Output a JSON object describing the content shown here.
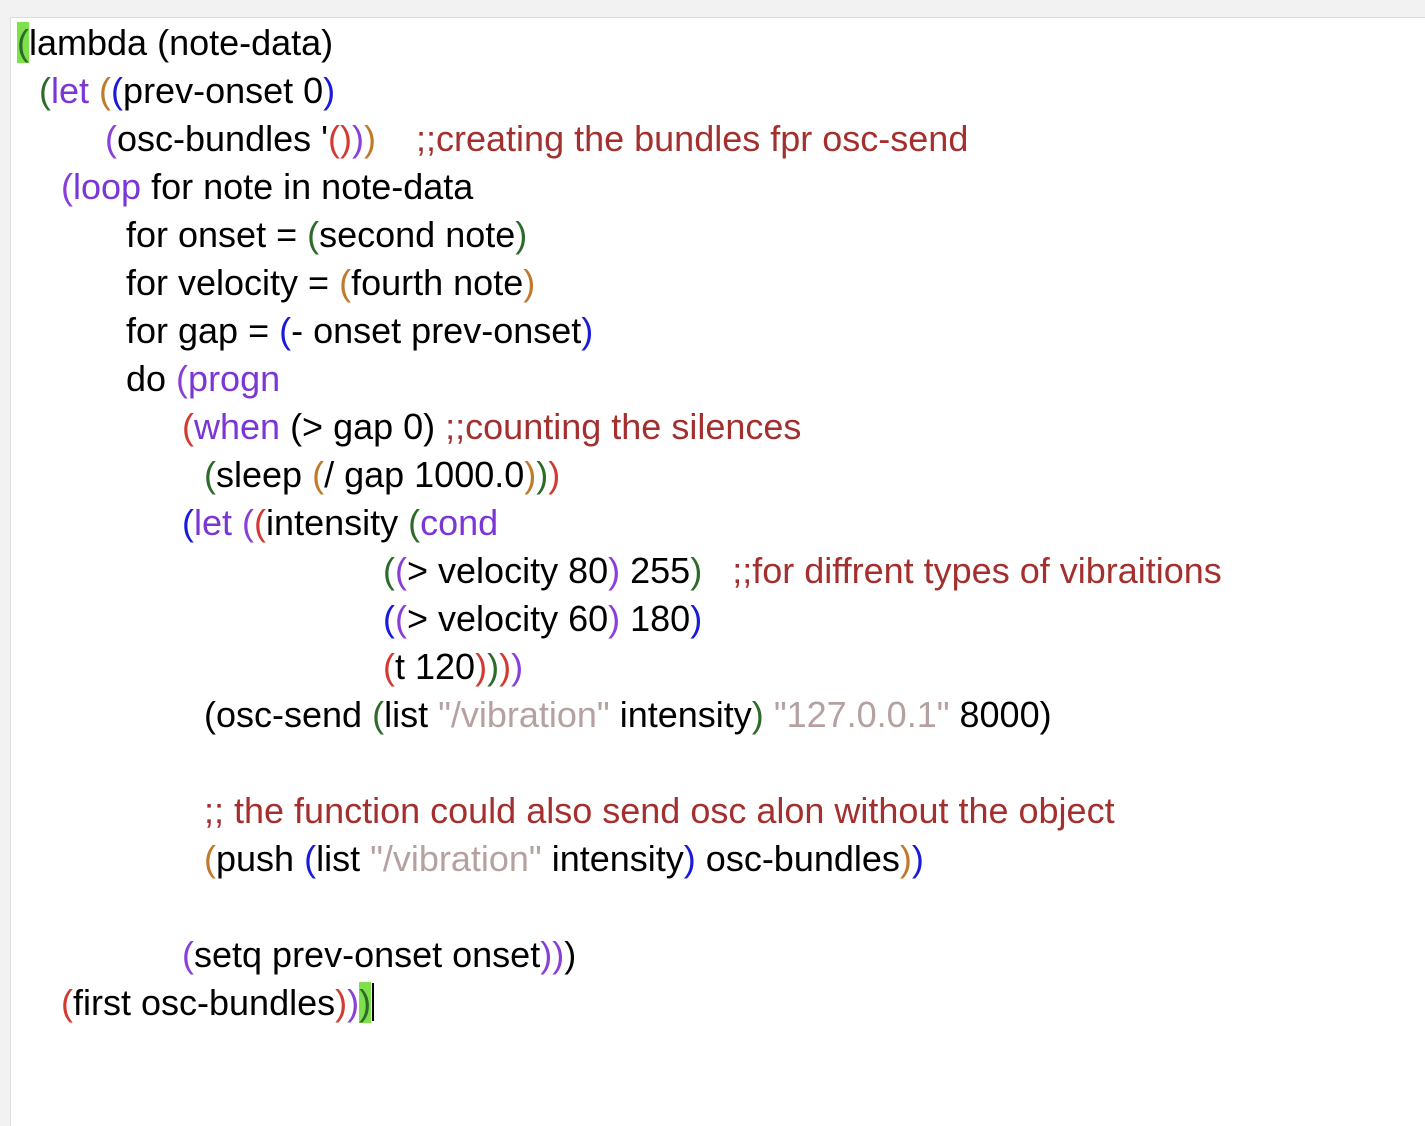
{
  "colors": {
    "default": "#000000",
    "keyword": "#7a37d6",
    "comment": "#a3302f",
    "string": "#b6a1a1",
    "match_highlight": "#7ee04a",
    "paren_green": "#2d6b2b",
    "paren_purple": "#8a3fd8",
    "paren_blue": "#1a1adb",
    "paren_orange": "#c17a2b",
    "paren_red": "#d23a32"
  },
  "editor": {
    "lines": [
      {
        "indent": 6,
        "tokens": [
          {
            "t": "(",
            "c": "paren_green",
            "hl": true
          },
          {
            "t": "lambda (note-data)"
          }
        ]
      },
      {
        "indent": 28,
        "tokens": [
          {
            "t": "(",
            "c": "paren_green"
          },
          {
            "t": "let",
            "c": "keyword"
          },
          {
            "t": " "
          },
          {
            "t": "(",
            "c": "paren_orange"
          },
          {
            "t": "(",
            "c": "paren_blue"
          },
          {
            "t": "prev-onset 0"
          },
          {
            "t": ")",
            "c": "paren_blue"
          }
        ]
      },
      {
        "indent": 94,
        "tokens": [
          {
            "t": "(",
            "c": "paren_purple"
          },
          {
            "t": "osc-bundles '"
          },
          {
            "t": "(",
            "c": "paren_red"
          },
          {
            "t": ")",
            "c": "paren_red"
          },
          {
            "t": ")",
            "c": "paren_purple"
          },
          {
            "t": ")",
            "c": "paren_orange"
          },
          {
            "t": "    "
          },
          {
            "t": ";;creating the bundles fpr osc-send",
            "c": "comment"
          }
        ]
      },
      {
        "indent": 50,
        "tokens": [
          {
            "t": "(",
            "c": "paren_purple"
          },
          {
            "t": "loop",
            "c": "keyword"
          },
          {
            "t": " for note in note-data"
          }
        ]
      },
      {
        "indent": 115,
        "tokens": [
          {
            "t": "for onset = "
          },
          {
            "t": "(",
            "c": "paren_green"
          },
          {
            "t": "second note"
          },
          {
            "t": ")",
            "c": "paren_green"
          }
        ]
      },
      {
        "indent": 115,
        "tokens": [
          {
            "t": "for velocity = "
          },
          {
            "t": "(",
            "c": "paren_orange"
          },
          {
            "t": "fourth note"
          },
          {
            "t": ")",
            "c": "paren_orange"
          }
        ]
      },
      {
        "indent": 115,
        "tokens": [
          {
            "t": "for gap = "
          },
          {
            "t": "(",
            "c": "paren_blue"
          },
          {
            "t": "- onset prev-onset"
          },
          {
            "t": ")",
            "c": "paren_blue"
          }
        ]
      },
      {
        "indent": 115,
        "tokens": [
          {
            "t": "do "
          },
          {
            "t": "(",
            "c": "paren_purple"
          },
          {
            "t": "progn",
            "c": "keyword"
          }
        ]
      },
      {
        "indent": 171,
        "tokens": [
          {
            "t": "(",
            "c": "paren_red"
          },
          {
            "t": "when",
            "c": "keyword"
          },
          {
            "t": " (> gap 0) "
          },
          {
            "t": ";;counting the silences",
            "c": "comment"
          }
        ]
      },
      {
        "indent": 193,
        "tokens": [
          {
            "t": "(",
            "c": "paren_green"
          },
          {
            "t": "sleep "
          },
          {
            "t": "(",
            "c": "paren_orange"
          },
          {
            "t": "/ gap 1000.0"
          },
          {
            "t": ")",
            "c": "paren_orange"
          },
          {
            "t": ")",
            "c": "paren_green"
          },
          {
            "t": ")",
            "c": "paren_red"
          }
        ]
      },
      {
        "indent": 171,
        "tokens": [
          {
            "t": "(",
            "c": "paren_blue"
          },
          {
            "t": "let",
            "c": "keyword"
          },
          {
            "t": " "
          },
          {
            "t": "(",
            "c": "paren_purple"
          },
          {
            "t": "(",
            "c": "paren_red"
          },
          {
            "t": "intensity "
          },
          {
            "t": "(",
            "c": "paren_green"
          },
          {
            "t": "cond",
            "c": "keyword"
          }
        ]
      },
      {
        "indent": 372,
        "tokens": [
          {
            "t": "(",
            "c": "paren_green"
          },
          {
            "t": "(",
            "c": "paren_purple"
          },
          {
            "t": "> velocity 80"
          },
          {
            "t": ")",
            "c": "paren_purple"
          },
          {
            "t": " 255"
          },
          {
            "t": ")",
            "c": "paren_green"
          },
          {
            "t": "   "
          },
          {
            "t": ";;for diffrent types of vibraitions",
            "c": "comment"
          }
        ]
      },
      {
        "indent": 372,
        "tokens": [
          {
            "t": "(",
            "c": "paren_blue"
          },
          {
            "t": "(",
            "c": "paren_purple"
          },
          {
            "t": "> velocity 60"
          },
          {
            "t": ")",
            "c": "paren_purple"
          },
          {
            "t": " 180"
          },
          {
            "t": ")",
            "c": "paren_blue"
          }
        ]
      },
      {
        "indent": 372,
        "tokens": [
          {
            "t": "(",
            "c": "paren_red"
          },
          {
            "t": "t 120"
          },
          {
            "t": ")",
            "c": "paren_red"
          },
          {
            "t": ")",
            "c": "paren_green"
          },
          {
            "t": ")",
            "c": "paren_red"
          },
          {
            "t": ")",
            "c": "paren_purple"
          }
        ]
      },
      {
        "indent": 193,
        "tokens": [
          {
            "t": "(osc-send "
          },
          {
            "t": "(",
            "c": "paren_green"
          },
          {
            "t": "list "
          },
          {
            "t": "\"/vibration\"",
            "c": "string"
          },
          {
            "t": " intensity"
          },
          {
            "t": ")",
            "c": "paren_green"
          },
          {
            "t": " "
          },
          {
            "t": "\"127.0.0.1\"",
            "c": "string"
          },
          {
            "t": " 8000)"
          }
        ]
      },
      {
        "indent": 0,
        "tokens": []
      },
      {
        "indent": 193,
        "tokens": [
          {
            "t": ";; the function could also send osc alon without the object",
            "c": "comment"
          }
        ]
      },
      {
        "indent": 193,
        "tokens": [
          {
            "t": "(",
            "c": "paren_orange"
          },
          {
            "t": "push "
          },
          {
            "t": "(",
            "c": "paren_blue"
          },
          {
            "t": "list "
          },
          {
            "t": "\"/vibration\"",
            "c": "string"
          },
          {
            "t": " intensity"
          },
          {
            "t": ")",
            "c": "paren_blue"
          },
          {
            "t": " osc-bundles"
          },
          {
            "t": ")",
            "c": "paren_orange"
          },
          {
            "t": ")",
            "c": "paren_blue"
          }
        ]
      },
      {
        "indent": 0,
        "tokens": []
      },
      {
        "indent": 171,
        "tokens": [
          {
            "t": "(",
            "c": "paren_purple"
          },
          {
            "t": "setq prev-onset onset"
          },
          {
            "t": ")",
            "c": "paren_purple"
          },
          {
            "t": ")",
            "c": "paren_purple"
          },
          {
            "t": ")"
          }
        ]
      },
      {
        "indent": 50,
        "tokens": [
          {
            "t": "(",
            "c": "paren_red"
          },
          {
            "t": "first osc-bundles"
          },
          {
            "t": ")",
            "c": "paren_red"
          },
          {
            "t": ")",
            "c": "paren_purple"
          },
          {
            "t": ")",
            "c": "paren_green",
            "hl": true
          }
        ],
        "caret": true
      }
    ]
  }
}
